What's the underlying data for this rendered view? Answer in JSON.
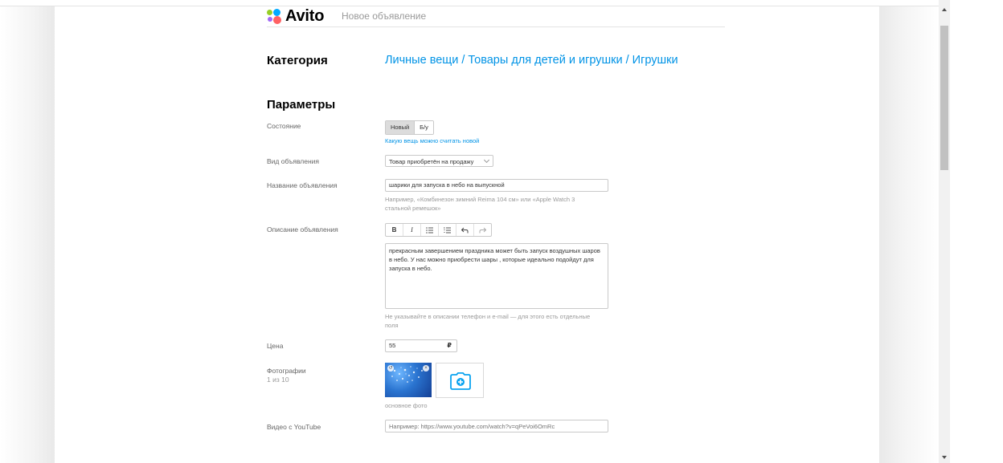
{
  "header": {
    "logo_text": "Avito",
    "subtitle": "Новое объявление",
    "logo_colors": [
      "#97cf26",
      "#0af",
      "#a169f7",
      "#ff6163"
    ]
  },
  "category": {
    "label": "Категория",
    "value": "Личные вещи / Товары для детей и игрушки / Игрушки"
  },
  "params": {
    "title": "Параметры",
    "condition": {
      "label": "Состояние",
      "options": [
        "Новый",
        "Б/у"
      ],
      "selected": "Новый",
      "help_link": "Какую вещь можно считать новой"
    },
    "ad_type": {
      "label": "Вид объявления",
      "selected": "Товар приобретён на продажу"
    },
    "ad_title": {
      "label": "Название объявления",
      "value": "шарики  для запуска в небо на выпускной",
      "hint": "Например, «Комбинезон зимний Reima 104 см» или «Apple Watch 3 стальной ремешок»"
    },
    "description": {
      "label": "Описание объявления",
      "toolbar": [
        "B",
        "I",
        "bulleted-list",
        "numbered-list",
        "undo",
        "redo"
      ],
      "value": "прекрасным завершением праздника может быть запуск воздушных шаров в небо. У нас можно приобрести шары , которые идеально подойдут для запуска в небо.",
      "hint": "Не указывайте в описании телефон и e-mail — для этого есть отдельные поля"
    },
    "price": {
      "label": "Цена",
      "value": "55",
      "currency": "₽"
    },
    "photos": {
      "label": "Фотографии",
      "count": "1 из 10",
      "caption": "основное фото"
    },
    "youtube": {
      "label": "Видео с YouTube",
      "placeholder": "Например: https://www.youtube.com/watch?v=qPeVoi6OmRc"
    }
  },
  "colors": {
    "link": "#0093e6",
    "border": "#c9c9c9"
  }
}
